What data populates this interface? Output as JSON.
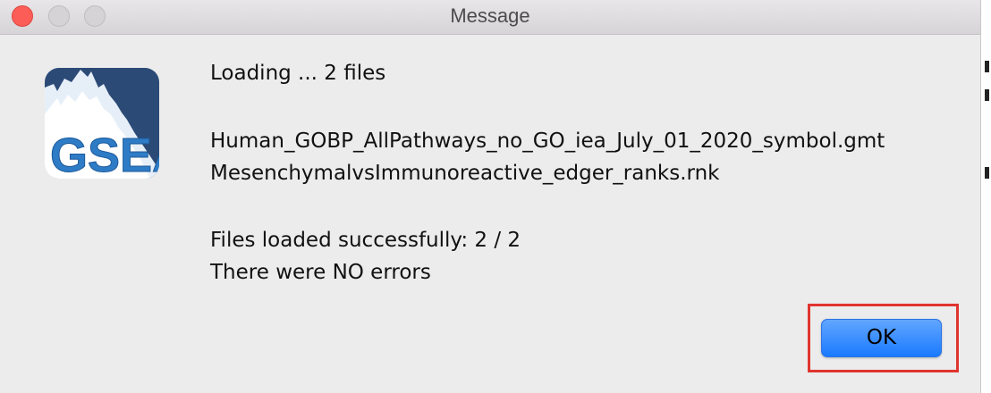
{
  "window": {
    "title": "Message"
  },
  "logo": {
    "text": "GSEA",
    "colors": {
      "background": "#2c4a76",
      "letters": "#2e7bc6"
    }
  },
  "message": {
    "loading_line": "Loading ... 2 files",
    "files": [
      "Human_GOBP_AllPathways_no_GO_iea_July_01_2020_symbol.gmt",
      "MesenchymalvsImmunoreactive_edger_ranks.rnk"
    ],
    "status_line": "Files loaded successfully: 2 / 2",
    "errors_line": "There were NO errors"
  },
  "buttons": {
    "ok_label": "OK"
  },
  "colors": {
    "highlight_box": "#e0352f",
    "ok_button": "#1a7aff",
    "close_light": "#fd5d57"
  }
}
